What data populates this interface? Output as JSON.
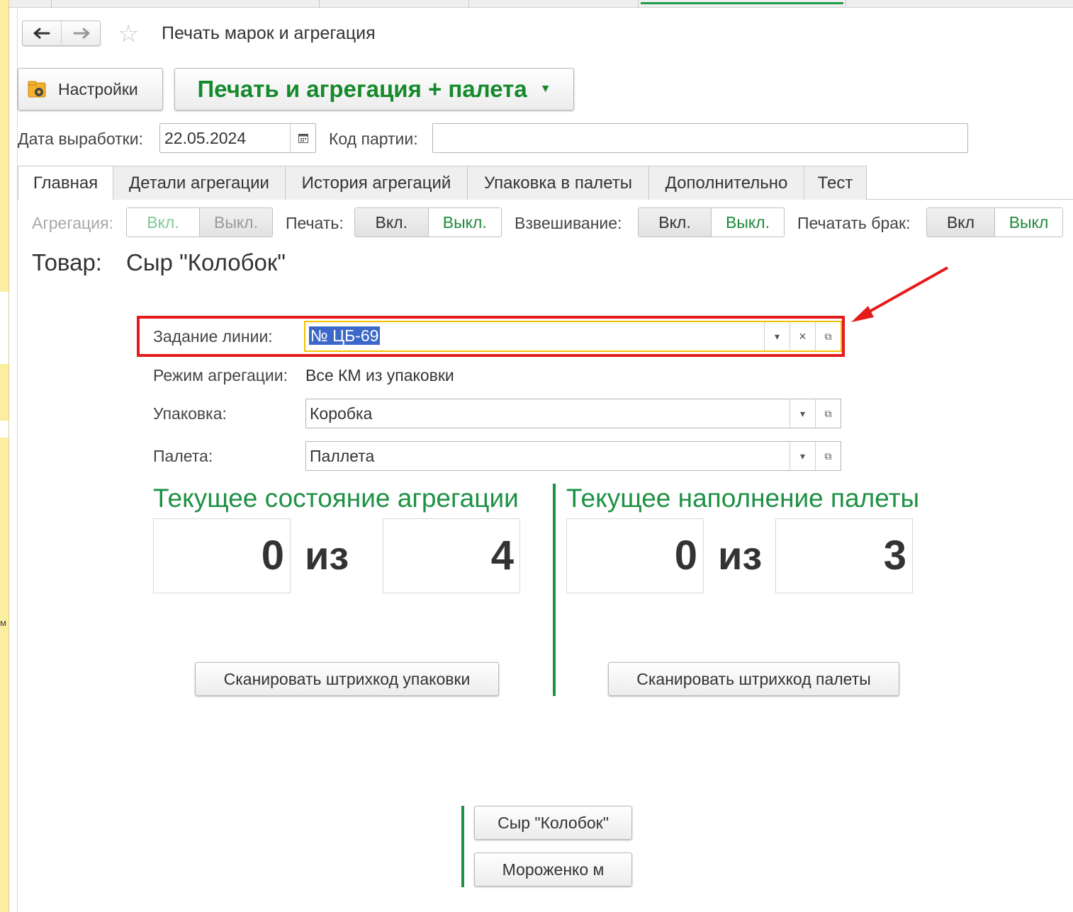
{
  "window": {
    "title": "Печать марок и агрегация",
    "left_strip_char": "м"
  },
  "toolbar": {
    "settings_label": "Настройки",
    "print_menu_label": "Печать и агрегация + палета"
  },
  "header_fields": {
    "date_label": "Дата выработки:",
    "date_value": "22.05.2024",
    "batch_label": "Код партии:",
    "batch_value": ""
  },
  "tabs": [
    {
      "label": "Главная",
      "active": true
    },
    {
      "label": "Детали агрегации"
    },
    {
      "label": "История агрегаций"
    },
    {
      "label": "Упаковка в палеты"
    },
    {
      "label": "Дополнительно"
    },
    {
      "label": "Тест"
    }
  ],
  "toggles": {
    "aggregation": {
      "label": "Агрегация:",
      "on": "Вкл.",
      "off": "Выкл."
    },
    "print": {
      "label": "Печать:",
      "on": "Вкл.",
      "off": "Выкл."
    },
    "weighing": {
      "label": "Взвешивание:",
      "on": "Вкл.",
      "off": "Выкл."
    },
    "print_defect": {
      "label": "Печатать брак:",
      "on": "Вкл",
      "off": "Выкл"
    }
  },
  "product": {
    "label": "Товар:",
    "value": "Сыр \"Колобок\""
  },
  "form": {
    "task_label": "Задание линии:",
    "task_value": "№ ЦБ-69",
    "mode_label": "Режим агрегации:",
    "mode_value": "Все КМ из упаковки",
    "package_label": "Упаковка:",
    "package_value": "Коробка",
    "pallet_label": "Палета:",
    "pallet_value": "Паллета"
  },
  "aggregation_state": {
    "title": "Текущее состояние агрегации",
    "current": "0",
    "of": "из",
    "total": "4",
    "scan_button": "Сканировать штрихкод упаковки"
  },
  "pallet_state": {
    "title": "Текущее наполнение палеты",
    "current": "0",
    "of": "из",
    "total": "3",
    "scan_button": "Сканировать штрихкод палеты"
  },
  "product_buttons": [
    "Сыр \"Колобок\"",
    "Мороженко м"
  ],
  "colors": {
    "accent_green": "#1d9144",
    "highlight_red": "#e51b1b",
    "selection_blue": "#3b68c9"
  }
}
